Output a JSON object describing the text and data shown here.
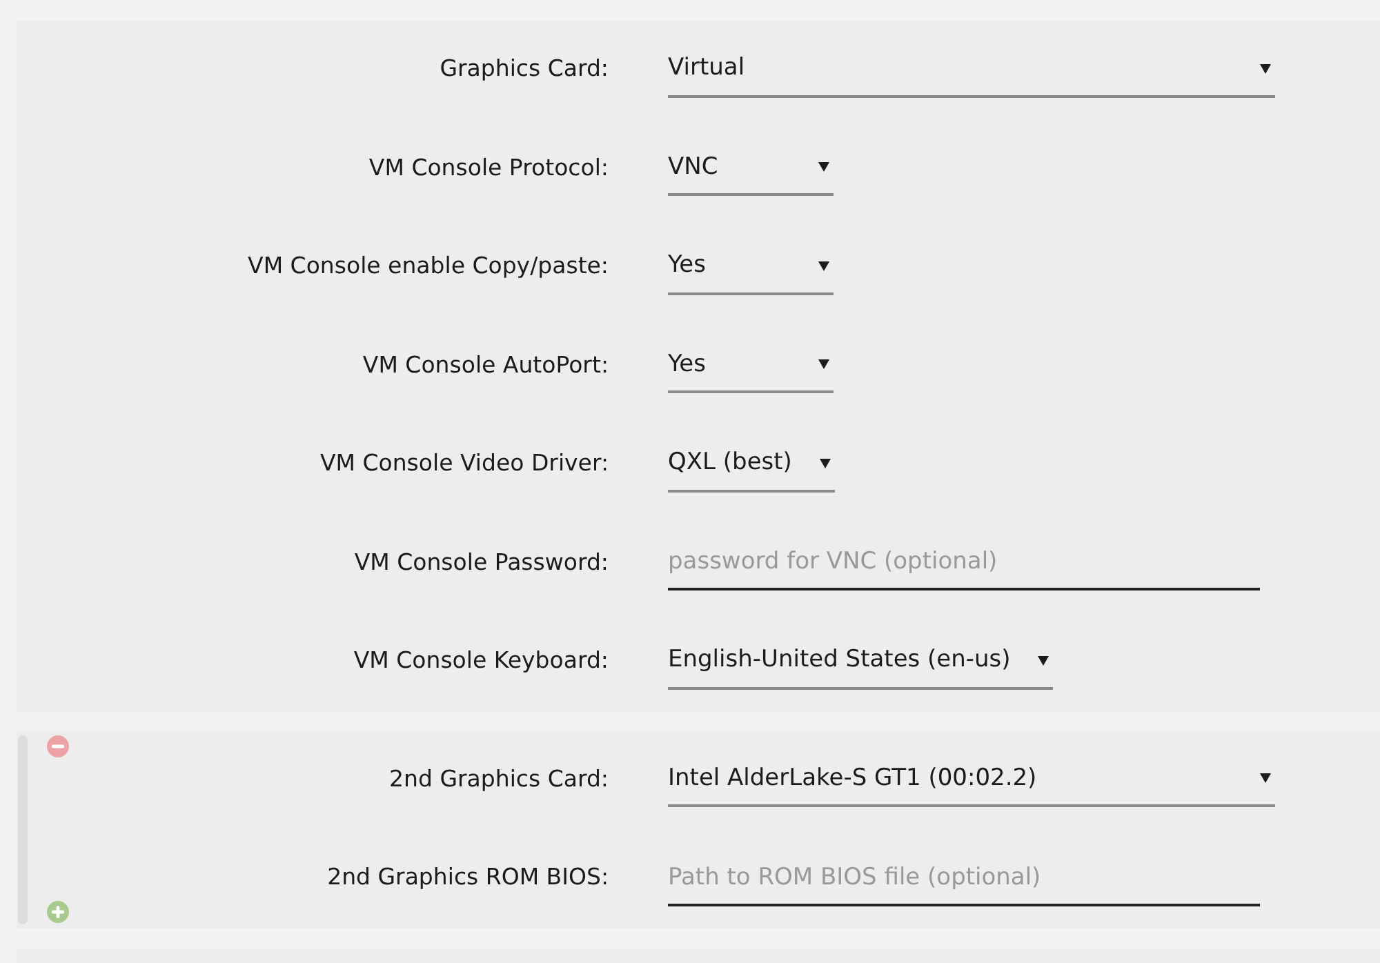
{
  "sections": [
    {
      "removable": false,
      "fields": [
        {
          "kind": "wideselect",
          "label": "Graphics Card:",
          "value": "Virtual"
        },
        {
          "kind": "select",
          "label": "VM Console Protocol:",
          "value": "VNC"
        },
        {
          "kind": "select",
          "label": "VM Console enable Copy/paste:",
          "value": "Yes"
        },
        {
          "kind": "select",
          "label": "VM Console AutoPort:",
          "value": "Yes"
        },
        {
          "kind": "select",
          "label": "VM Console Video Driver:",
          "value": "QXL (best)"
        },
        {
          "kind": "input",
          "label": "VM Console Password:",
          "placeholder": "password for VNC (optional)"
        },
        {
          "kind": "select",
          "label": "VM Console Keyboard:",
          "value": "English-United States (en-us)"
        }
      ]
    },
    {
      "removable": true,
      "fields": [
        {
          "kind": "wideselect",
          "label": "2nd Graphics Card:",
          "value": "Intel AlderLake-S GT1 (00:02.2)"
        },
        {
          "kind": "input",
          "label": "2nd Graphics ROM BIOS:",
          "placeholder": "Path to ROM BIOS file (optional)"
        }
      ]
    }
  ]
}
